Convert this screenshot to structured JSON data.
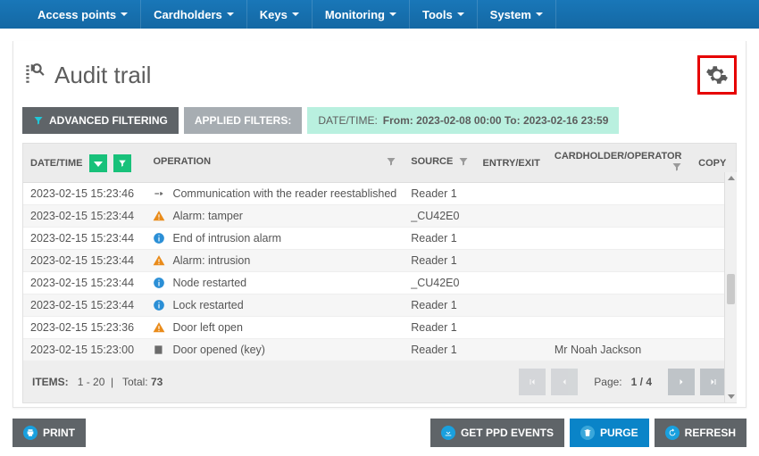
{
  "nav": [
    "Access points",
    "Cardholders",
    "Keys",
    "Monitoring",
    "Tools",
    "System"
  ],
  "page_title": "Audit trail",
  "buttons": {
    "advanced_filtering": "ADVANCED FILTERING",
    "applied_filters": "APPLIED FILTERS:",
    "filter_chip_label": "DATE/TIME:",
    "filter_chip_value": "From: 2023-02-08 00:00 To: 2023-02-16 23:59",
    "print": "PRINT",
    "get_ppd": "GET PPD EVENTS",
    "purge": "PURGE",
    "refresh": "REFRESH"
  },
  "columns": {
    "datetime": "DATE/TIME",
    "operation": "OPERATION",
    "source": "SOURCE",
    "entry_exit": "ENTRY/EXIT",
    "cardholder": "CARDHOLDER/OPERATOR",
    "copy": "COPY"
  },
  "rows": [
    {
      "dt": "2023-02-15 15:23:46",
      "icon": "link",
      "op": "Communication with the reader reestablished",
      "src": "Reader 1",
      "card": ""
    },
    {
      "dt": "2023-02-15 15:23:44",
      "icon": "warn",
      "op": "Alarm: tamper",
      "src": "_CU42E0",
      "card": ""
    },
    {
      "dt": "2023-02-15 15:23:44",
      "icon": "info",
      "op": "End of intrusion alarm",
      "src": "Reader 1",
      "card": ""
    },
    {
      "dt": "2023-02-15 15:23:44",
      "icon": "warn",
      "op": "Alarm: intrusion",
      "src": "Reader 1",
      "card": ""
    },
    {
      "dt": "2023-02-15 15:23:44",
      "icon": "info",
      "op": "Node restarted",
      "src": "_CU42E0",
      "card": ""
    },
    {
      "dt": "2023-02-15 15:23:44",
      "icon": "info",
      "op": "Lock restarted",
      "src": "Reader 1",
      "card": ""
    },
    {
      "dt": "2023-02-15 15:23:36",
      "icon": "warn",
      "op": "Door left open",
      "src": "Reader 1",
      "card": ""
    },
    {
      "dt": "2023-02-15 15:23:00",
      "icon": "key",
      "op": "Door opened (key)",
      "src": "Reader 1",
      "card": "Mr Noah Jackson"
    }
  ],
  "footer": {
    "items_label": "ITEMS:",
    "items_range": "1 - 20",
    "total_label": "Total:",
    "total_value": "73",
    "page_label": "Page:",
    "page_value": "1 / 4"
  }
}
